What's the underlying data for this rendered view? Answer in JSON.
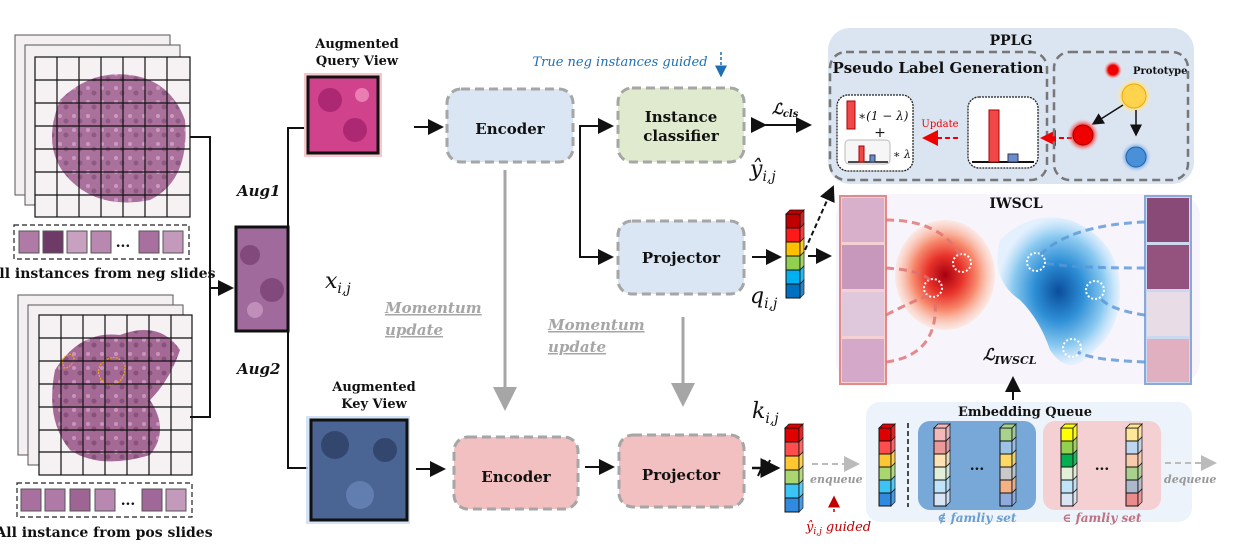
{
  "figure": {
    "left": {
      "neg_caption": "All instances from neg slides",
      "pos_caption": "All instance from pos slides",
      "ellipsis": "...",
      "aug1": "Aug1",
      "aug2": "Aug2",
      "input_label": "x",
      "input_sub": "i,j"
    },
    "query_view": {
      "title_line1": "Augmented",
      "title_line2": "Query View"
    },
    "key_view": {
      "title_line1": "Augmented",
      "title_line2": "Key View"
    },
    "query_branch": {
      "encoder": "Encoder",
      "classifier_line1": "Instance",
      "classifier_line2": "classifier",
      "projector": "Projector",
      "guided_note": "True neg instances guided",
      "y_hat": "ŷ",
      "y_hat_sub": "i,j",
      "q_label": "q",
      "q_sub": "i,j",
      "loss_cls": "ℒ",
      "loss_cls_sub": "cls"
    },
    "key_branch": {
      "encoder": "Encoder",
      "projector": "Projector",
      "k_label": "k",
      "k_sub": "i,j",
      "momentum1_line1": "Momentum",
      "momentum1_line2": "update",
      "momentum2_line1": "Momentum",
      "momentum2_line2": "update"
    },
    "pplg": {
      "title": "PPLG",
      "plg_title": "Pseudo Label Generation",
      "formula_top": "∗(1 − λ)",
      "formula_plus": "+",
      "formula_bottom": "∗ λ",
      "update_label": "Update",
      "prototype_label": "Prototype"
    },
    "iwscl": {
      "title": "IWSCL",
      "loss": "ℒ",
      "loss_sub": "IWSCL"
    },
    "queue": {
      "title": "Embedding Queue",
      "enqueue": "enqueue",
      "dequeue": "dequeue",
      "guided": "ŷ",
      "guided_sub": "i,j",
      "guided_word": "guided",
      "ellipsis": "...",
      "not_family": "∉ famliy set",
      "in_family": "∈ famliy set"
    },
    "colors": {
      "query_box": "#dae6f3",
      "key_box": "#f2c0c0",
      "classifier_box": "#dfeacf",
      "pplg_bg": "#dbe4f1",
      "iwscl_bg": "#f8f4fb",
      "queue_bg": "#edf3fa",
      "not_family_bg": "#78a8d8",
      "in_family_bg": "#f4d0d2",
      "guided_blue": "#1f6fb4",
      "guided_red": "#c00000",
      "momentum_gray": "#a6a6a6"
    },
    "vectors": {
      "q": [
        "#c00000",
        "#ff1a1a",
        "#ffc000",
        "#92d050",
        "#00b0f0",
        "#0070c0"
      ],
      "k": [
        "#e00000",
        "#ff4d4d",
        "#ffc832",
        "#a9d66e",
        "#3cc4f5",
        "#2f8ae0"
      ],
      "queue_first": [
        "#e00000",
        "#ff4d4d",
        "#ffc832",
        "#a9d66e",
        "#3cc4f5",
        "#2f8ae0"
      ],
      "notfam_a": [
        "#f4b8b8",
        "#ea9898",
        "#ffe2b4",
        "#e2efd9",
        "#bfe3f8",
        "#d9e4f4"
      ],
      "notfam_b": [
        "#a9d18e",
        "#9dc3e6",
        "#ffd966",
        "#c9c9c9",
        "#f4b183",
        "#8faadc"
      ],
      "fam_a": [
        "#ffff00",
        "#92d050",
        "#00b050",
        "#e2efd9",
        "#bfe3f8",
        "#d9e4f4"
      ],
      "fam_b": [
        "#ffe699",
        "#bdd7ee",
        "#f8cbad",
        "#a9d18e",
        "#adb9ca",
        "#ea8c8c"
      ]
    }
  }
}
